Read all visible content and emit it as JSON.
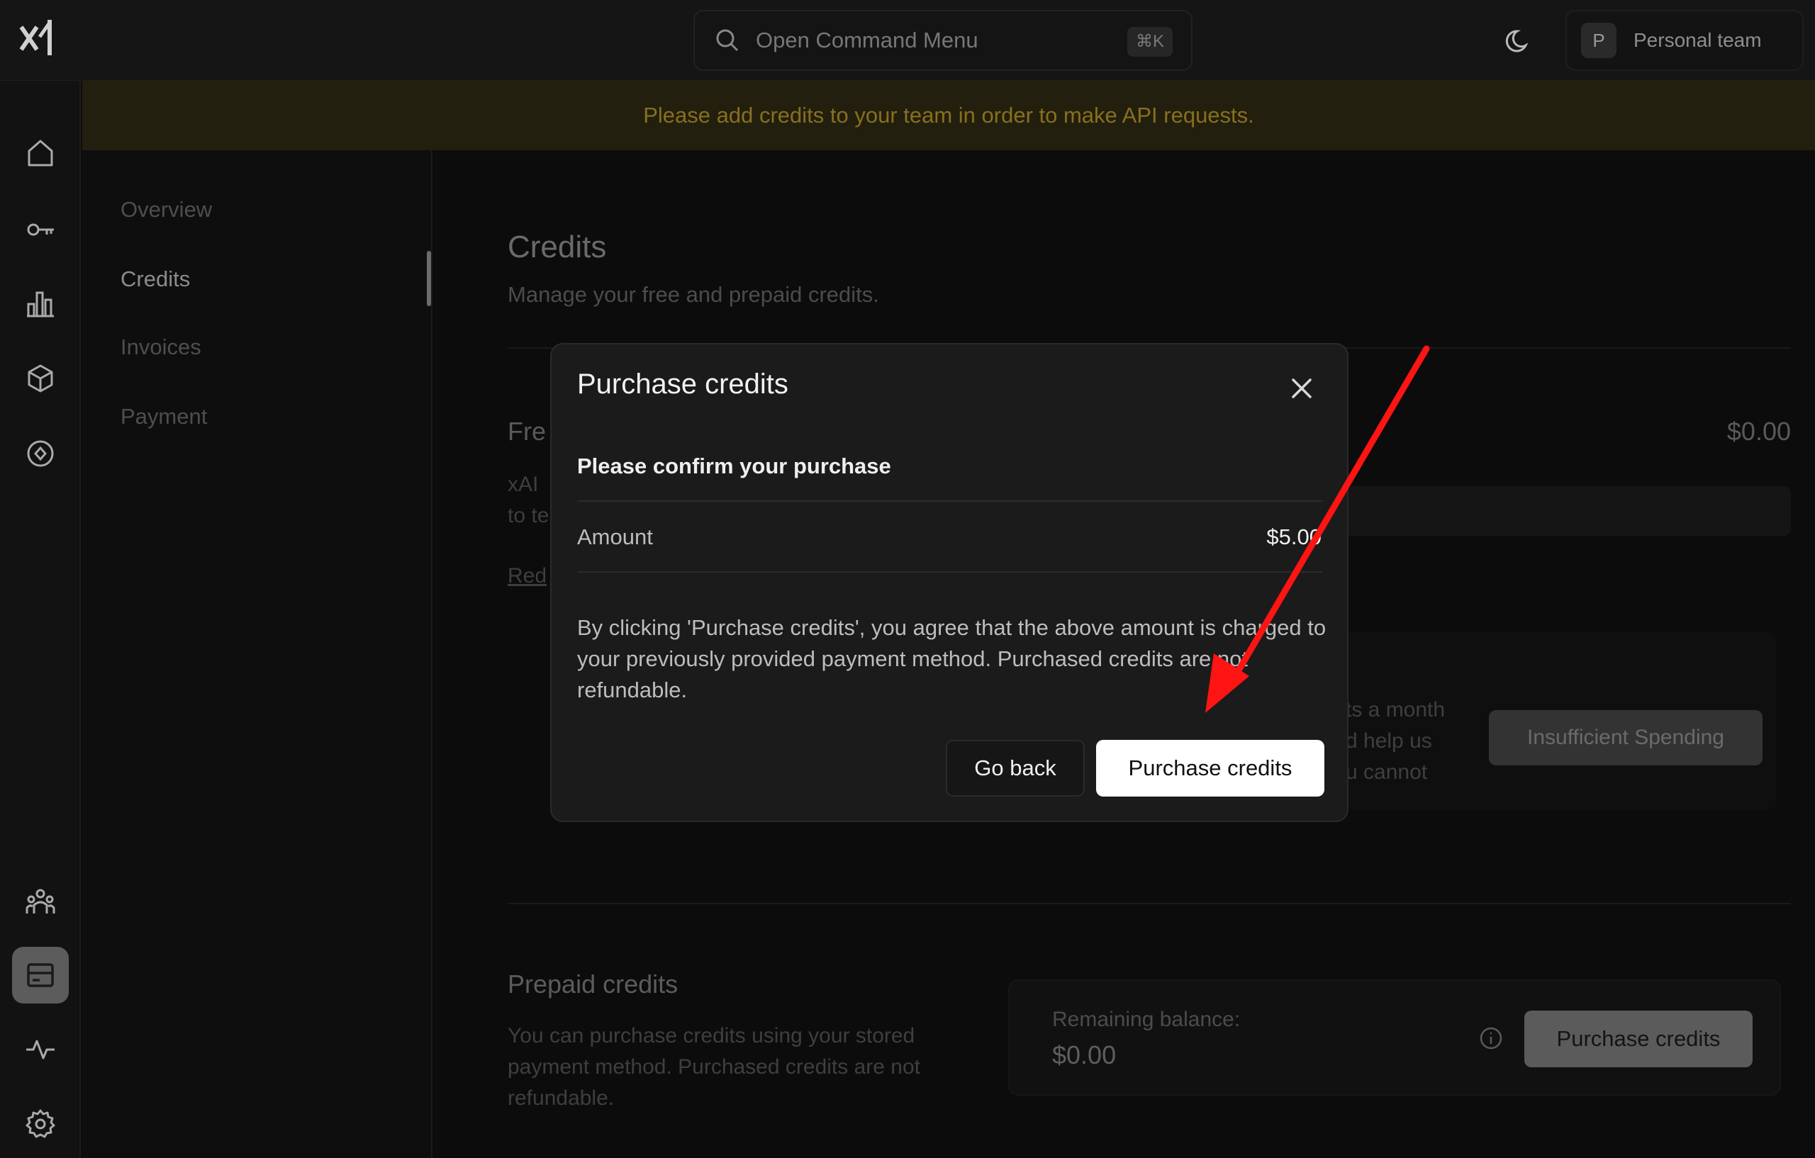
{
  "topbar": {
    "command_menu_label": "Open Command Menu",
    "command_menu_shortcut": "⌘K",
    "team_avatar_letter": "P",
    "team_name": "Personal team"
  },
  "banner": {
    "text": "Please add credits to your team in order to make API requests.",
    "color": "#87701e"
  },
  "rail": {
    "icons": [
      "home-icon",
      "key-icon",
      "bar-chart-icon",
      "cube-icon",
      "compass-icon",
      "team-icon",
      "billing-icon",
      "activity-icon",
      "gear-icon"
    ],
    "active": "billing-icon"
  },
  "subnav": {
    "items": [
      "Overview",
      "Credits",
      "Invoices",
      "Payment"
    ],
    "active": "Credits"
  },
  "page": {
    "title": "Credits",
    "subtitle": "Manage your free and prepaid credits.",
    "free_title_partial": "Fre",
    "free_desc_partial_1": "xAI",
    "free_desc_partial_2": "to te",
    "redeem_partial": "Red",
    "free_amount": "$0.00",
    "spend_text_1": "ts a month",
    "spend_text_2": "d help us",
    "spend_text_3": "u cannot",
    "insufficient_label": "Insufficient Spending",
    "prepaid_title": "Prepaid credits",
    "prepaid_desc": "You can purchase credits using your stored payment method. Purchased credits are not refundable.",
    "remaining_label": "Remaining balance:",
    "remaining_value": "$0.00",
    "purchase_button": "Purchase credits"
  },
  "modal": {
    "title": "Purchase credits",
    "subtitle": "Please confirm your purchase",
    "amount_label": "Amount",
    "amount_value": "$5.00",
    "description": "By clicking 'Purchase credits', you agree that the above amount is charged to your previously provided payment method. Purchased credits are not refundable.",
    "go_back_label": "Go back",
    "confirm_label": "Purchase credits"
  },
  "annotation": {
    "arrow_color": "#ff1414"
  }
}
